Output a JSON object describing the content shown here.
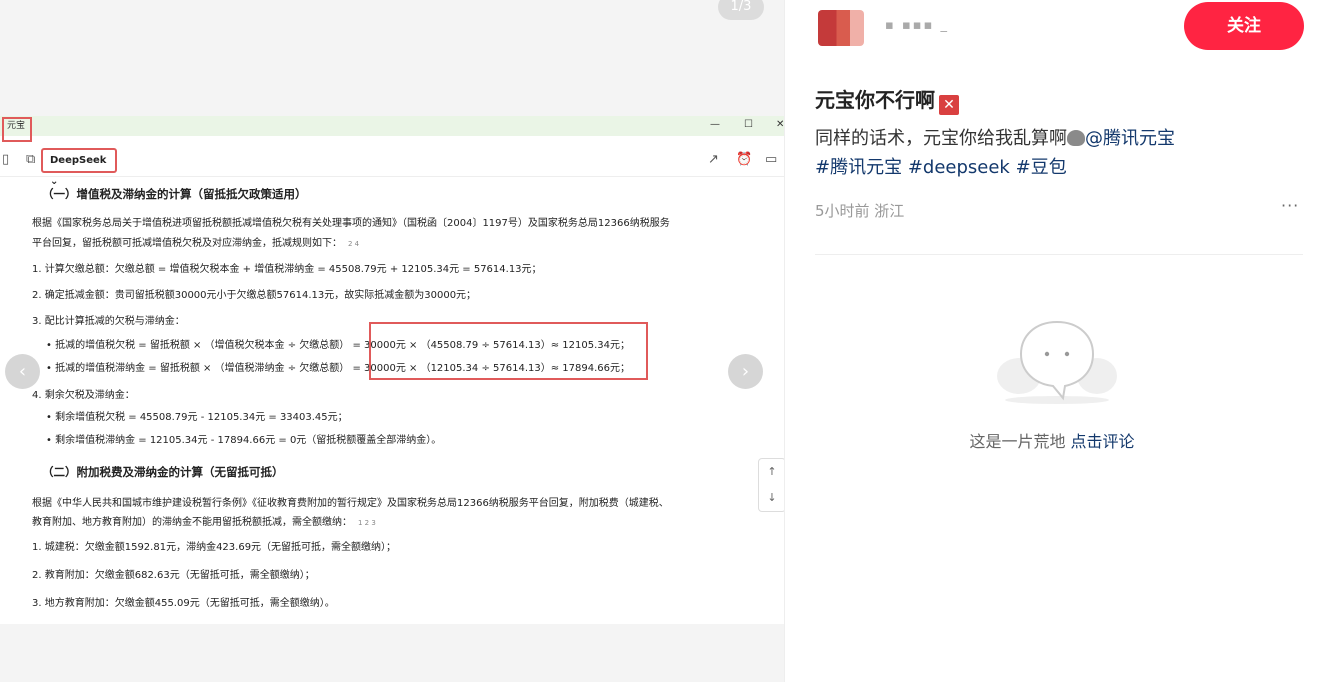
{
  "media": {
    "counter": "1/3",
    "prev_icon": "chevron-left-icon",
    "next_icon": "chevron-right-icon",
    "screenshot": {
      "window_title": "元宝",
      "model_selector": "DeepSeek ⌄",
      "scroll_up": "↑",
      "scroll_down": "↓",
      "lines": [
        "（一）增值税及滞纳金的计算（留抵抵欠政策适用）",
        "根据《国家税务总局关于增值税进项留抵税额抵减增值税欠税有关处理事项的通知》（国税函〔2004〕1197号）及国家税务总局12366纳税服务",
        "平台回复，留抵税额可抵减增值税欠税及对应滞纳金，抵减规则如下：",
        "1. 计算欠缴总额：欠缴总额 = 增值税欠税本金 + 增值税滞纳金 = 45508.79元 + 12105.34元 = 57614.13元；",
        "2. 确定抵减金额：贵司留抵税额30000元小于欠缴总额57614.13元，故实际抵减金额为30000元；",
        "3. 配比计算抵减的欠税与滞纳金：",
        "• 抵减的增值税欠税 = 留抵税额 × （增值税欠税本金 ÷ 欠缴总额） = 30000元 × （45508.79 ÷ 57614.13）≈ 12105.34元；",
        "• 抵减的增值税滞纳金 = 留抵税额 × （增值税滞纳金 ÷ 欠缴总额） = 30000元 × （12105.34 ÷ 57614.13）≈ 17894.66元；",
        "4. 剩余欠税及滞纳金：",
        "• 剩余增值税欠税 = 45508.79元 - 12105.34元 = 33403.45元；",
        "• 剩余增值税滞纳金 = 12105.34元 - 17894.66元 = 0元（留抵税额覆盖全部滞纳金）。",
        "（二）附加税费及滞纳金的计算（无留抵可抵）",
        "根据《中华人民共和国城市维护建设税暂行条例》《征收教育费附加的暂行规定》及国家税务总局12366纳税服务平台回复，附加税费（城建税、",
        "教育附加、地方教育附加）的滞纳金不能用留抵税额抵减，需全额缴纳：",
        "1. 城建税：欠缴金额1592.81元，滞纳金423.69元（无留抵可抵，需全额缴纳）；",
        "2. 教育附加：欠缴金额682.63元（无留抵可抵，需全额缴纳）；",
        "3. 地方教育附加：欠缴金额455.09元（无留抵可抵，需全额缴纳）。"
      ],
      "refs_a": "2 4",
      "refs_b": "1 2 3"
    }
  },
  "panel": {
    "username": "▪ ▪▪▪ _",
    "follow_label": "关注",
    "title": "元宝你不行啊",
    "title_icon": "cross-mark-icon",
    "body_text": "同样的话术，元宝你给我乱算啊",
    "mention": "@腾讯元宝",
    "tags": [
      "#腾讯元宝",
      "#deepseek",
      "#豆包"
    ],
    "meta": "5小时前 浙江",
    "more": "···",
    "empty_text": "这是一片荒地",
    "empty_link": "点击评论"
  }
}
